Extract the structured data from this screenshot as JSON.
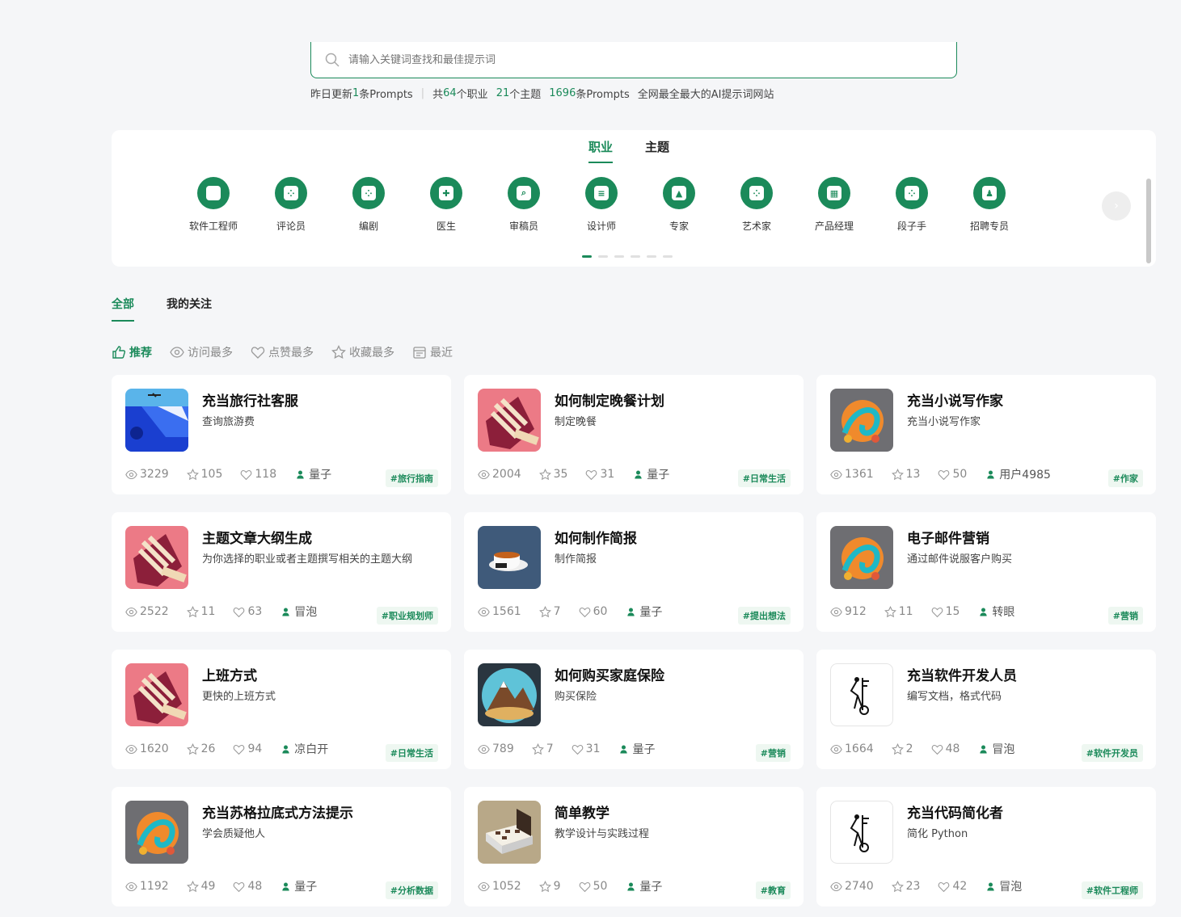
{
  "search": {
    "placeholder": "请输入关键词查找和最佳提示词"
  },
  "stats": {
    "updated_prefix": "昨日更新",
    "updated_count": "1",
    "updated_suffix": "条Prompts",
    "total_prefix": "共",
    "jobs_count": "64",
    "jobs_suffix": "个职业",
    "themes_count": "21",
    "themes_suffix": "个主题",
    "prompts_count": "1696",
    "prompts_suffix": "条Prompts",
    "slogan": "全网最全最大的AI提示词网站"
  },
  "category_tabs": [
    "职业",
    "主题"
  ],
  "categories": [
    {
      "label": "软件工程师",
      "icon": "code-icon"
    },
    {
      "label": "评论员",
      "icon": "grid-icon"
    },
    {
      "label": "编剧",
      "icon": "grid-icon"
    },
    {
      "label": "医生",
      "icon": "medkit-icon"
    },
    {
      "label": "审稿员",
      "icon": "search-doc-icon"
    },
    {
      "label": "设计师",
      "icon": "document-icon"
    },
    {
      "label": "专家",
      "icon": "graduation-cap-icon"
    },
    {
      "label": "艺术家",
      "icon": "grid-icon"
    },
    {
      "label": "产品经理",
      "icon": "blocks-icon"
    },
    {
      "label": "段子手",
      "icon": "grid-icon"
    },
    {
      "label": "招聘专员",
      "icon": "people-icon"
    }
  ],
  "feed_tabs": [
    "全部",
    "我的关注"
  ],
  "sorts": [
    {
      "label": "推荐",
      "icon": "thumbs-up-icon"
    },
    {
      "label": "访问最多",
      "icon": "eye-icon"
    },
    {
      "label": "点赞最多",
      "icon": "heart-icon"
    },
    {
      "label": "收藏最多",
      "icon": "star-icon"
    },
    {
      "label": "最近",
      "icon": "calendar-icon"
    }
  ],
  "cards": [
    {
      "title": "充当旅行社客服",
      "desc": "查询旅游费",
      "views": "3229",
      "stars": "105",
      "likes": "118",
      "user": "量子",
      "tag": "#旅行指南",
      "thumb": "runway"
    },
    {
      "title": "如何制定晚餐计划",
      "desc": "制定晚餐",
      "views": "2004",
      "stars": "35",
      "likes": "31",
      "user": "量子",
      "tag": "#日常生活",
      "thumb": "shoe"
    },
    {
      "title": "充当小说写作家",
      "desc": "充当小说写作家",
      "views": "1361",
      "stars": "13",
      "likes": "50",
      "user": "用户4985",
      "tag": "#作家",
      "thumb": "swirl"
    },
    {
      "title": "主题文章大纲生成",
      "desc": "为你选择的职业或者主题撰写相关的主题大纲",
      "views": "2522",
      "stars": "11",
      "likes": "63",
      "user": "冒泡",
      "tag": "#职业规划师",
      "thumb": "shoe"
    },
    {
      "title": "如何制作简报",
      "desc": "制作简报",
      "views": "1561",
      "stars": "7",
      "likes": "60",
      "user": "量子",
      "tag": "#提出想法",
      "thumb": "cup"
    },
    {
      "title": "电子邮件营销",
      "desc": "通过邮件说服客户购买",
      "views": "912",
      "stars": "11",
      "likes": "15",
      "user": "转眼",
      "tag": "#营销",
      "thumb": "swirl"
    },
    {
      "title": "上班方式",
      "desc": "更快的上班方式",
      "views": "1620",
      "stars": "26",
      "likes": "94",
      "user": "凉白开",
      "tag": "#日常生活",
      "thumb": "shoe"
    },
    {
      "title": "如何购买家庭保险",
      "desc": "购买保险",
      "views": "789",
      "stars": "7",
      "likes": "31",
      "user": "量子",
      "tag": "#营销",
      "thumb": "mountain"
    },
    {
      "title": "充当软件开发人员",
      "desc": "编写文档，格式代码",
      "views": "1664",
      "stars": "2",
      "likes": "48",
      "user": "冒泡",
      "tag": "#软件开发员",
      "thumb": "sketch"
    },
    {
      "title": "充当苏格拉底式方法提示",
      "desc": "学会质疑他人",
      "views": "1192",
      "stars": "49",
      "likes": "48",
      "user": "量子",
      "tag": "#分析数据",
      "thumb": "swirl"
    },
    {
      "title": "简单教学",
      "desc": "教学设计与实践过程",
      "views": "1052",
      "stars": "9",
      "likes": "50",
      "user": "量子",
      "tag": "#教育",
      "thumb": "boxes"
    },
    {
      "title": "充当代码简化者",
      "desc": "简化 Python",
      "views": "2740",
      "stars": "23",
      "likes": "42",
      "user": "冒泡",
      "tag": "#软件工程师",
      "thumb": "sketch"
    }
  ],
  "colors": {
    "accent": "#1b8a5a",
    "background": "#f5f6f8"
  }
}
